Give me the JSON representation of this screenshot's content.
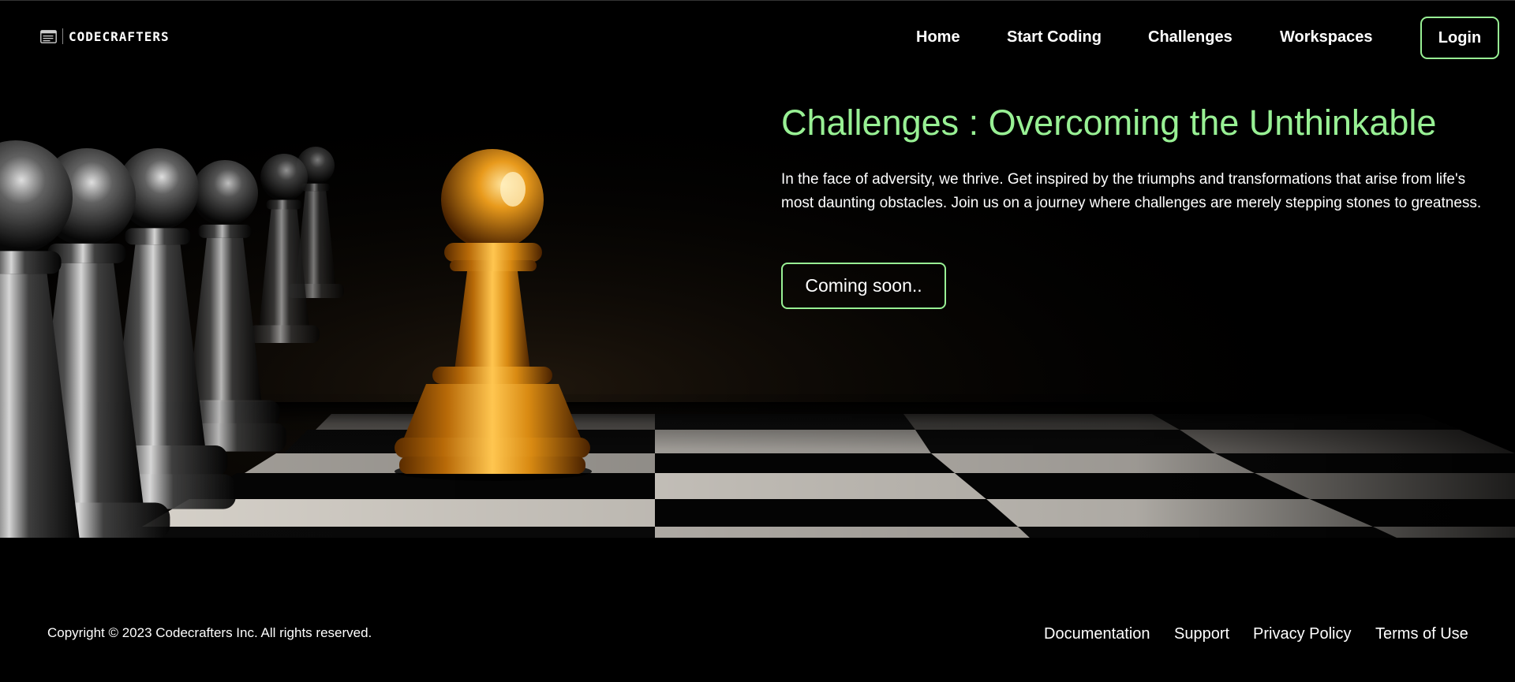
{
  "brand": {
    "name": "CODECRAFTERS",
    "icon": "terminal-window-icon"
  },
  "nav": {
    "links": [
      {
        "label": "Home"
      },
      {
        "label": "Start Coding"
      },
      {
        "label": "Challenges"
      },
      {
        "label": "Workspaces"
      }
    ],
    "login_label": "Login"
  },
  "hero": {
    "title": "Challenges : Overcoming the Unthinkable",
    "description": "In the face of adversity, we thrive. Get inspired by the triumphs and transformations that arise from life's most daunting obstacles. Join us on a journey where challenges are merely stepping stones to greatness.",
    "cta_label": "Coming soon..",
    "image": "chess-pawns-gold-pawn-leading-image"
  },
  "footer": {
    "copyright": "Copyright © 2023 Codecrafters Inc. All rights reserved.",
    "links": [
      {
        "label": "Documentation"
      },
      {
        "label": "Support"
      },
      {
        "label": "Privacy Policy"
      },
      {
        "label": "Terms of Use"
      }
    ]
  },
  "colors": {
    "accent": "#98f094",
    "background": "#000000",
    "text": "#ffffff",
    "gold": "#d98a12"
  }
}
